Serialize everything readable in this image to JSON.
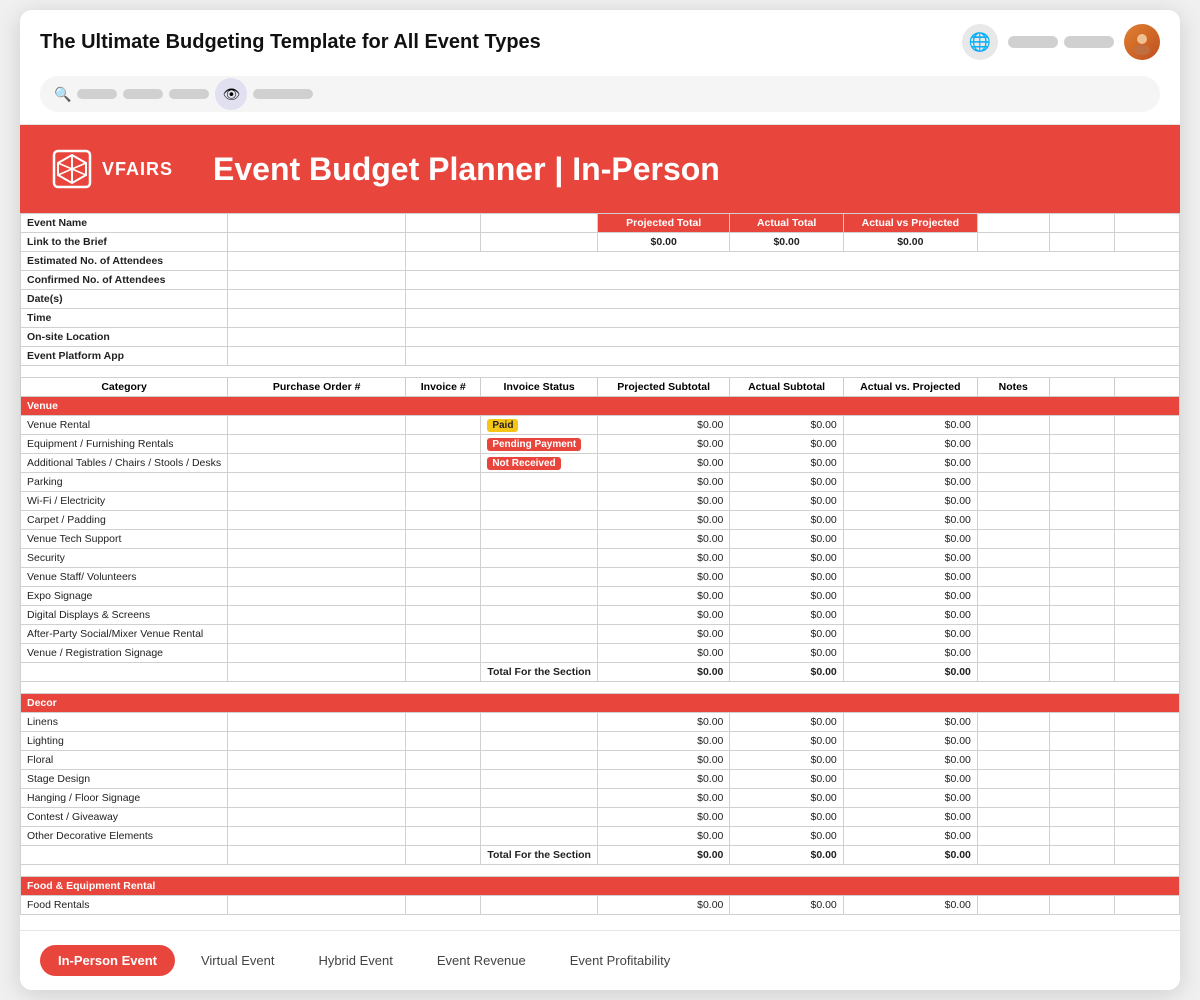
{
  "browser": {
    "title": "The Ultimate Budgeting Template for All Event Types"
  },
  "header": {
    "logo_text": "vFAIRS",
    "spreadsheet_title": "Event Budget Planner | In-Person"
  },
  "info_rows": [
    {
      "label": "Event Name"
    },
    {
      "label": "Link to the Brief"
    },
    {
      "label": "Estimated No. of Attendees"
    },
    {
      "label": "Confirmed No. of Attendees"
    },
    {
      "label": "Date(s)"
    },
    {
      "label": "Time"
    },
    {
      "label": "On-site Location"
    },
    {
      "label": "Event Platform App"
    }
  ],
  "summary_headers": [
    "Projected Total",
    "Actual Total",
    "Actual vs Projected"
  ],
  "summary_values": [
    "$0.00",
    "$0.00",
    "$0.00"
  ],
  "col_headers": [
    "Category",
    "Purchase Order #",
    "Invoice #",
    "Invoice Status",
    "Projected Subtotal",
    "Actual Subtotal",
    "Actual vs. Projected",
    "Notes"
  ],
  "sections": [
    {
      "name": "Venue",
      "rows": [
        {
          "name": "Venue Rental",
          "status": "Paid",
          "status_type": "paid",
          "proj": "$0.00",
          "actual": "$0.00",
          "vs": "$0.00"
        },
        {
          "name": "Equipment / Furnishing Rentals",
          "status": "Pending Payment",
          "status_type": "pending",
          "proj": "$0.00",
          "actual": "$0.00",
          "vs": "$0.00"
        },
        {
          "name": "Additional Tables / Chairs / Stools / Desks",
          "status": "Not Received",
          "status_type": "not-received",
          "proj": "$0.00",
          "actual": "$0.00",
          "vs": "$0.00"
        },
        {
          "name": "Parking",
          "status": "",
          "status_type": "",
          "proj": "$0.00",
          "actual": "$0.00",
          "vs": "$0.00"
        },
        {
          "name": "Wi-Fi / Electricity",
          "status": "",
          "status_type": "",
          "proj": "$0.00",
          "actual": "$0.00",
          "vs": "$0.00"
        },
        {
          "name": "Carpet / Padding",
          "status": "",
          "status_type": "",
          "proj": "$0.00",
          "actual": "$0.00",
          "vs": "$0.00"
        },
        {
          "name": "Venue Tech Support",
          "status": "",
          "status_type": "",
          "proj": "$0.00",
          "actual": "$0.00",
          "vs": "$0.00"
        },
        {
          "name": "Security",
          "status": "",
          "status_type": "",
          "proj": "$0.00",
          "actual": "$0.00",
          "vs": "$0.00"
        },
        {
          "name": "Venue Staff/ Volunteers",
          "status": "",
          "status_type": "",
          "proj": "$0.00",
          "actual": "$0.00",
          "vs": "$0.00"
        },
        {
          "name": "Expo Signage",
          "status": "",
          "status_type": "",
          "proj": "$0.00",
          "actual": "$0.00",
          "vs": "$0.00"
        },
        {
          "name": "Digital Displays & Screens",
          "status": "",
          "status_type": "",
          "proj": "$0.00",
          "actual": "$0.00",
          "vs": "$0.00"
        },
        {
          "name": "After-Party Social/Mixer Venue Rental",
          "status": "",
          "status_type": "",
          "proj": "$0.00",
          "actual": "$0.00",
          "vs": "$0.00"
        },
        {
          "name": "Venue / Registration Signage",
          "status": "",
          "status_type": "",
          "proj": "$0.00",
          "actual": "$0.00",
          "vs": "$0.00"
        }
      ],
      "total_label": "Total For the Section",
      "total_proj": "$0.00",
      "total_actual": "$0.00",
      "total_vs": "$0.00"
    },
    {
      "name": "Decor",
      "rows": [
        {
          "name": "Linens",
          "proj": "$0.00",
          "actual": "$0.00",
          "vs": "$0.00"
        },
        {
          "name": "Lighting",
          "proj": "$0.00",
          "actual": "$0.00",
          "vs": "$0.00"
        },
        {
          "name": "Floral",
          "proj": "$0.00",
          "actual": "$0.00",
          "vs": "$0.00"
        },
        {
          "name": "Stage Design",
          "proj": "$0.00",
          "actual": "$0.00",
          "vs": "$0.00"
        },
        {
          "name": "Hanging / Floor Signage",
          "proj": "$0.00",
          "actual": "$0.00",
          "vs": "$0.00"
        },
        {
          "name": "Contest / Giveaway",
          "proj": "$0.00",
          "actual": "$0.00",
          "vs": "$0.00"
        },
        {
          "name": "Other Decorative Elements",
          "proj": "$0.00",
          "actual": "$0.00",
          "vs": "$0.00"
        }
      ],
      "total_label": "Total For the Section",
      "total_proj": "$0.00",
      "total_actual": "$0.00",
      "total_vs": "$0.00"
    },
    {
      "name": "Food & Equipment Rental",
      "rows": [
        {
          "name": "Food Rentals",
          "proj": "$0.00",
          "actual": "$0.00",
          "vs": "$0.00"
        }
      ]
    }
  ],
  "tabs": [
    {
      "label": "In-Person Event",
      "active": true
    },
    {
      "label": "Virtual Event",
      "active": false
    },
    {
      "label": "Hybrid Event",
      "active": false
    },
    {
      "label": "Event Revenue",
      "active": false
    },
    {
      "label": "Event Profitability",
      "active": false
    }
  ]
}
